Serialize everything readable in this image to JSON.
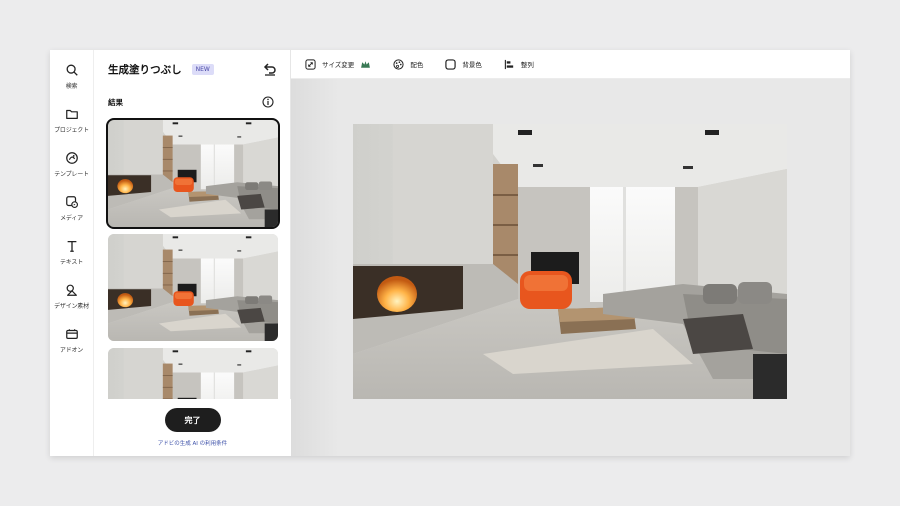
{
  "rail": {
    "items": [
      {
        "label": "検索",
        "icon": "search-icon"
      },
      {
        "label": "プロジェクト",
        "icon": "folder-icon"
      },
      {
        "label": "テンプレート",
        "icon": "template-icon"
      },
      {
        "label": "メディア",
        "icon": "media-icon"
      },
      {
        "label": "テキスト",
        "icon": "text-icon"
      },
      {
        "label": "デザイン素材",
        "icon": "shapes-icon"
      },
      {
        "label": "アドオン",
        "icon": "addon-icon"
      }
    ]
  },
  "panel": {
    "title": "生成塗りつぶし",
    "badge": "NEW",
    "section_label": "結果",
    "done_label": "完了",
    "terms_label": "アドビの生成 AI の利用条件"
  },
  "toolbar": {
    "tools": [
      {
        "label": "サイズ変更",
        "icon": "resize-icon",
        "premium": true
      },
      {
        "label": "配色",
        "icon": "palette-icon"
      },
      {
        "label": "背景色",
        "icon": "background-color-icon"
      },
      {
        "label": "整列",
        "icon": "align-icon"
      }
    ]
  },
  "colors": {
    "accent": "#1e1e1e",
    "badge_bg": "#dcdcf8",
    "link": "#3b4fa8",
    "chair": "#e8561e"
  }
}
